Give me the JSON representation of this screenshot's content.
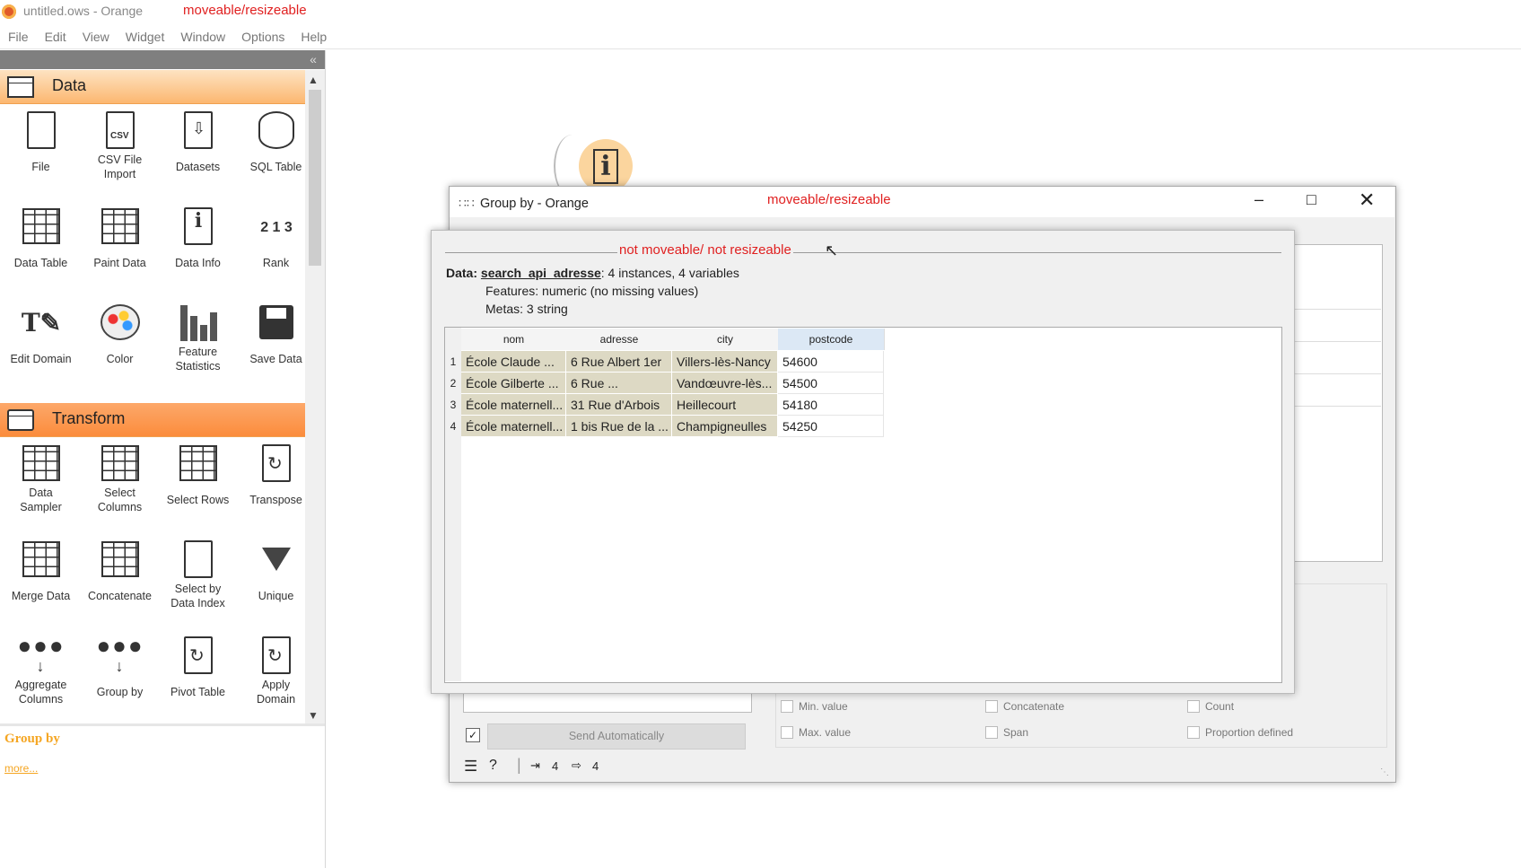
{
  "app": {
    "title": "untitled.ows - Orange",
    "annotation": "moveable/resizeable"
  },
  "menu": [
    "File",
    "Edit",
    "View",
    "Widget",
    "Window",
    "Options",
    "Help"
  ],
  "toolbox": {
    "collapse_glyph": "«",
    "categories": [
      {
        "label": "Data",
        "widgets": [
          {
            "label": "File",
            "icon": "file-icon"
          },
          {
            "label": "CSV File\nImport",
            "icon": "csv-icon"
          },
          {
            "label": "Datasets",
            "icon": "datasets-icon"
          },
          {
            "label": "SQL Table",
            "icon": "database-icon"
          },
          {
            "label": "Data Table",
            "icon": "table-icon"
          },
          {
            "label": "Paint Data",
            "icon": "paint-icon"
          },
          {
            "label": "Data Info",
            "icon": "info-icon"
          },
          {
            "label": "Rank",
            "icon": "rank-icon"
          },
          {
            "label": "Edit Domain",
            "icon": "edit-domain-icon"
          },
          {
            "label": "Color",
            "icon": "palette-icon"
          },
          {
            "label": "Feature\nStatistics",
            "icon": "bar-stats-icon"
          },
          {
            "label": "Save Data",
            "icon": "save-icon"
          }
        ]
      },
      {
        "label": "Transform",
        "widgets": [
          {
            "label": "Data\nSampler",
            "icon": "dice-icon"
          },
          {
            "label": "Select\nColumns",
            "icon": "select-columns-icon"
          },
          {
            "label": "Select Rows",
            "icon": "select-rows-icon"
          },
          {
            "label": "Transpose",
            "icon": "transpose-icon"
          },
          {
            "label": "Merge Data",
            "icon": "merge-icon"
          },
          {
            "label": "Concatenate",
            "icon": "concatenate-icon"
          },
          {
            "label": "Select by\nData Index",
            "icon": "select-index-icon"
          },
          {
            "label": "Unique",
            "icon": "funnel-icon"
          },
          {
            "label": "Aggregate\nColumns",
            "icon": "aggregate-icon"
          },
          {
            "label": "Group by",
            "icon": "group-by-icon"
          },
          {
            "label": "Pivot Table",
            "icon": "pivot-icon"
          },
          {
            "label": "Apply\nDomain",
            "icon": "apply-domain-icon"
          }
        ]
      }
    ]
  },
  "help": {
    "title": "Group by",
    "more": "more..."
  },
  "groupby_window": {
    "title": "Group by - Orange",
    "annotation": "moveable/resizeable",
    "send_label": "Send Automatically",
    "send_checked": "✓",
    "checkboxes": [
      {
        "label": "Min. value"
      },
      {
        "label": "Concatenate"
      },
      {
        "label": "Count"
      },
      {
        "label": "Max. value"
      },
      {
        "label": "Span"
      },
      {
        "label": "Proportion defined"
      }
    ],
    "status": {
      "input_count": "4",
      "output_count": "4"
    }
  },
  "info_window": {
    "annotation": "not moveable/ not resizeable",
    "data_label": "Data:",
    "dataset_name": "search_api_adresse",
    "summary": ": 4 instances, 4 variables",
    "features": "Features: numeric (no missing values)",
    "metas": "Metas: 3 string",
    "table": {
      "columns": [
        "nom",
        "adresse",
        "city",
        "postcode"
      ],
      "rows": [
        {
          "num": "1",
          "cells": [
            "École Claude ...",
            "6 Rue Albert 1er",
            "Villers-lès-Nancy",
            "54600"
          ]
        },
        {
          "num": "2",
          "cells": [
            "École Gilberte ...",
            "6 Rue ...",
            "Vandœuvre-lès...",
            "54500"
          ]
        },
        {
          "num": "3",
          "cells": [
            "École maternell...",
            "31 Rue d'Arbois",
            "Heillecourt",
            "54180"
          ]
        },
        {
          "num": "4",
          "cells": [
            "École maternell...",
            "1 bis Rue de la ...",
            "Champigneulles",
            "54250"
          ]
        }
      ]
    }
  }
}
